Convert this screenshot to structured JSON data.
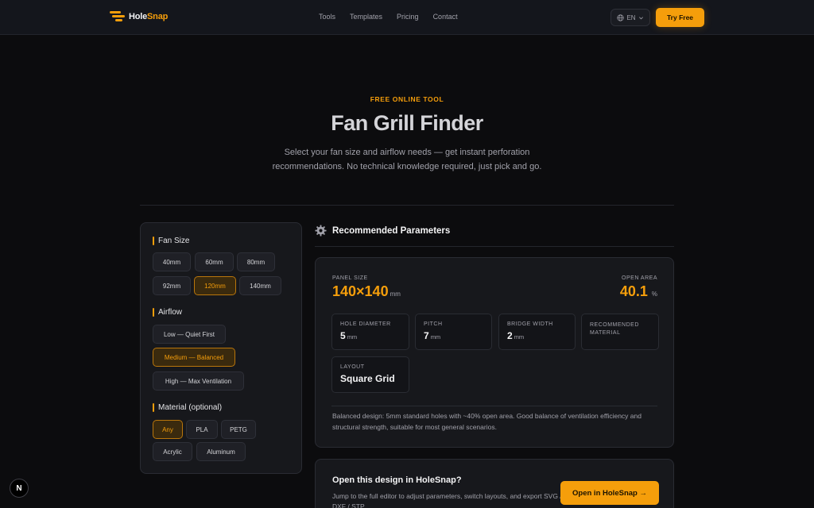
{
  "header": {
    "logo_prefix": "Hole",
    "logo_suffix": "Snap",
    "nav": [
      "Tools",
      "Templates",
      "Pricing",
      "Contact"
    ],
    "language": "EN",
    "cta": "Try Free"
  },
  "hero": {
    "eyebrow": "FREE ONLINE TOOL",
    "title": "Fan Grill Finder",
    "subtitle": "Select your fan size and airflow needs — get instant perforation recommendations. No technical knowledge required, just pick and go."
  },
  "form": {
    "fan_size": {
      "title": "Fan Size",
      "options": [
        "40mm",
        "60mm",
        "80mm",
        "92mm",
        "120mm",
        "140mm"
      ],
      "selected": "120mm"
    },
    "airflow": {
      "title": "Airflow",
      "options": [
        "Low — Quiet First",
        "Medium — Balanced",
        "High — Max Ventilation"
      ],
      "selected": "Medium — Balanced"
    },
    "material": {
      "title": "Material (optional)",
      "options": [
        "Any",
        "PLA",
        "PETG",
        "Acrylic",
        "Aluminum"
      ],
      "selected": "Any"
    }
  },
  "result": {
    "heading": "Recommended Parameters",
    "panel_size": {
      "label": "PANEL SIZE",
      "value": "140×140",
      "unit": "mm"
    },
    "open_area": {
      "label": "OPEN AREA",
      "value": "40.1",
      "unit": "%"
    },
    "hole_diameter": {
      "label": "HOLE DIAMETER",
      "value": "5",
      "unit": "mm"
    },
    "pitch": {
      "label": "PITCH",
      "value": "7",
      "unit": "mm"
    },
    "bridge_width": {
      "label": "BRIDGE WIDTH",
      "value": "2",
      "unit": "mm"
    },
    "material": {
      "label": "RECOMMENDED MATERIAL",
      "value": ""
    },
    "layout": {
      "label": "LAYOUT",
      "value": "Square Grid"
    },
    "description": "Balanced design: 5mm standard holes with ~40% open area. Good balance of ventilation efficiency and structural strength, suitable for most general scenarios."
  },
  "cta": {
    "title": "Open this design in HoleSnap?",
    "subtitle": "Jump to the full editor to adjust parameters, switch layouts, and export SVG / DXF / STP.",
    "button": "Open in HoleSnap →"
  },
  "badge": "N",
  "colors": {
    "accent": "#f59e0b",
    "background": "#0c0c0e",
    "card": "#17181c"
  },
  "icons": {
    "logo": "stacked-bars-logo-icon",
    "language": "globe-icon",
    "dropdown": "chevron-down-icon",
    "settings": "gear-icon"
  }
}
